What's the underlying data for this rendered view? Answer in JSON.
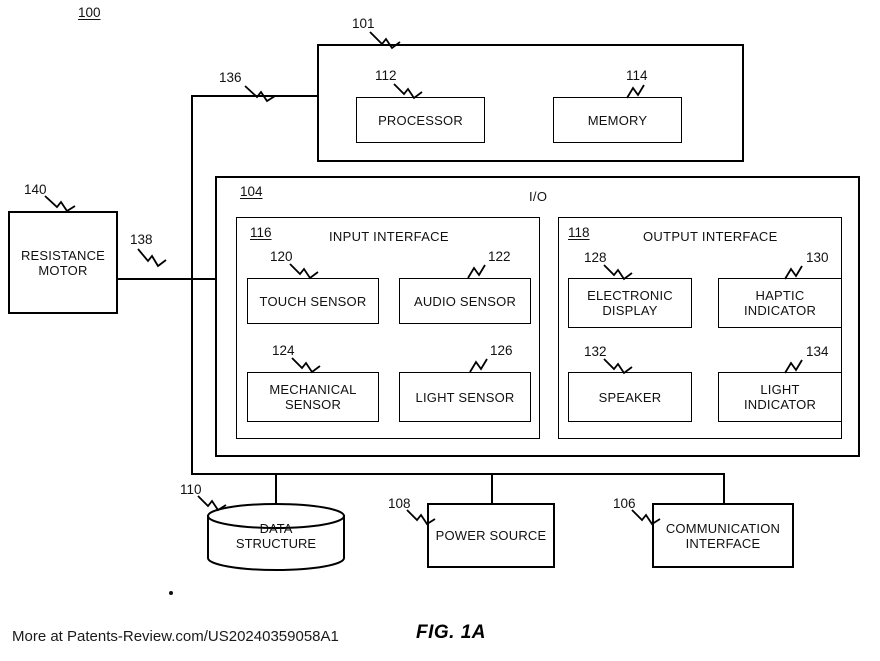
{
  "figure": {
    "caption": "FIG. 1A",
    "system_ref": "100",
    "watermark": "More at Patents-Review.com/US20240359058A1"
  },
  "computing_device": {
    "ref": "101",
    "processor": {
      "ref": "112",
      "label": "PROCESSOR"
    },
    "memory": {
      "ref": "114",
      "label": "MEMORY"
    }
  },
  "io": {
    "ref": "104",
    "title": "I/O",
    "input_interface": {
      "ref": "116",
      "title": "INPUT INTERFACE",
      "items": [
        {
          "ref": "120",
          "label": "TOUCH SENSOR"
        },
        {
          "ref": "122",
          "label": "AUDIO SENSOR"
        },
        {
          "ref": "124",
          "label": "MECHANICAL\nSENSOR"
        },
        {
          "ref": "126",
          "label": "LIGHT SENSOR"
        }
      ]
    },
    "output_interface": {
      "ref": "118",
      "title": "OUTPUT INTERFACE",
      "items": [
        {
          "ref": "128",
          "label": "ELECTRONIC\nDISPLAY"
        },
        {
          "ref": "130",
          "label": "HAPTIC\nINDICATOR"
        },
        {
          "ref": "132",
          "label": "SPEAKER"
        },
        {
          "ref": "134",
          "label": "LIGHT\nINDICATOR"
        }
      ]
    }
  },
  "resistance_motor": {
    "ref": "140",
    "label": "RESISTANCE\nMOTOR",
    "connection_ref": "138"
  },
  "bus": {
    "top_connection_ref": "136"
  },
  "peripherals": [
    {
      "ref": "110",
      "label": "DATA\nSTRUCTURE",
      "shape": "cylinder"
    },
    {
      "ref": "108",
      "label": "POWER SOURCE",
      "shape": "rect"
    },
    {
      "ref": "106",
      "label": "COMMUNICATION\nINTERFACE",
      "shape": "rect"
    }
  ],
  "colors": {
    "line": "#000000",
    "text": "#111111",
    "background": "#ffffff"
  }
}
